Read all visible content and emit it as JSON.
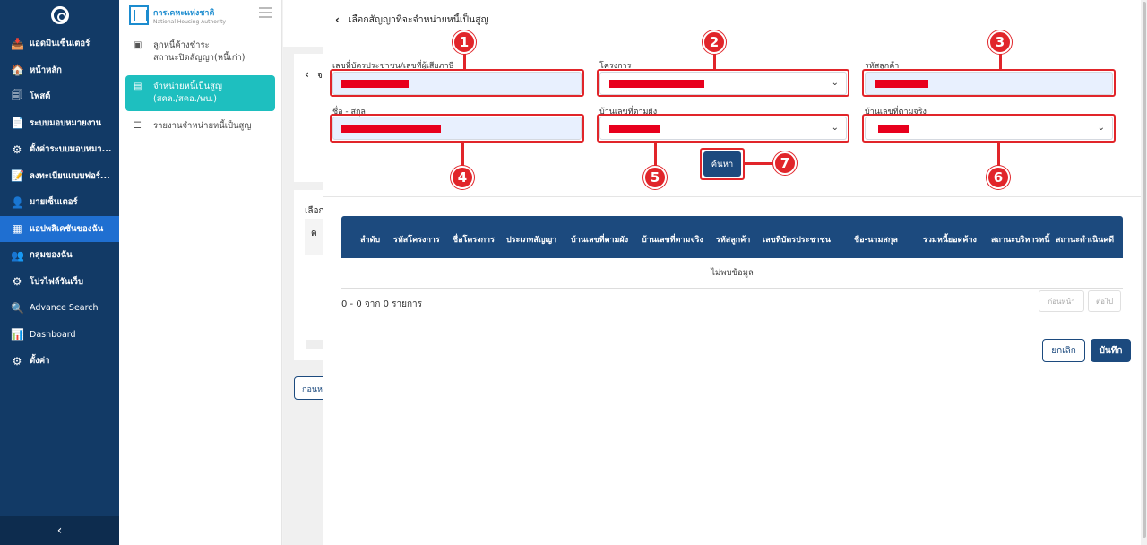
{
  "sidebar": {
    "items": [
      {
        "icon": "📥",
        "label": "แอดมินเซ็นเตอร์"
      },
      {
        "icon": "🏠",
        "label": "หน้าหลัก"
      },
      {
        "icon": "🗐",
        "label": "โพสต์"
      },
      {
        "icon": "📄",
        "label": "ระบบมอบหมายงาน"
      },
      {
        "icon": "⚙",
        "label": "ตั้งค่าระบบมอบหมา..."
      },
      {
        "icon": "📝",
        "label": "ลงทะเบียนแบบฟอร์..."
      },
      {
        "icon": "👤",
        "label": "มายเซ็นเตอร์"
      },
      {
        "icon": "▦",
        "label": "แอปพลิเคชันของฉัน"
      },
      {
        "icon": "👥",
        "label": "กลุ่มของฉัน"
      },
      {
        "icon": "⚙",
        "label": "โปรไฟล์วันเว็บ"
      },
      {
        "icon": "🔍",
        "label": "Advance Search"
      },
      {
        "icon": "📊",
        "label": "Dashboard"
      },
      {
        "icon": "⚙",
        "label": "ตั้งค่า"
      }
    ],
    "collapse_icon": "‹"
  },
  "brand": {
    "name_th": "การเคหะแห่งชาติ",
    "name_en": "National Housing Authority"
  },
  "subnav": {
    "items": [
      {
        "label_1": "ลูกหนี้ค้างชำระ",
        "label_2": "สถานะปิดสัญญา(หนี้เก่า)"
      },
      {
        "label_1": "จำหน่ายหนี้เป็นสูญ",
        "label_2": "(สคล./สคอ./พบ.)"
      },
      {
        "label_1": "รายงานจำหน่ายหนี้เป็นสูญ",
        "label_2": ""
      }
    ]
  },
  "background_page": {
    "back_symbol": "‹",
    "back_char": "จ",
    "label_1": "เลือก",
    "label_2": "ต",
    "prev_label": "ก่อนห"
  },
  "modal": {
    "title": "เลือกสัญญาที่จะจำหน่ายหนี้เป็นสูญ",
    "fields": {
      "id_label": "เลขที่บัตรประชาชน/เลขที่ผู้เสียภาษี",
      "project_label": "โครงการ",
      "customer_code_label": "รหัสลูกค้า",
      "name_label": "ชื่อ - สกุล",
      "house_reg_label": "บ้านเลขที่ตามผัง",
      "house_actual_label": "บ้านเลขที่ตามจริง"
    },
    "search_label": "ค้นหา",
    "table": {
      "headers": [
        "ลำดับ",
        "รหัสโครงการ",
        "ชื่อโครงการ",
        "ประเภทสัญญา",
        "บ้านเลขที่ตามผัง",
        "บ้านเลขที่ตามจริง",
        "รหัสลูกค้า",
        "เลขที่บัตรประชาชน",
        "ชื่อ-นามสกุล",
        "รวมหนี้ยอดค้าง",
        "สถานะบริหารหนี้",
        "สถานะดำเนินคดี"
      ],
      "empty_text": "ไม่พบข้อมูล",
      "record_count": "0 - 0 จาก 0 รายการ",
      "prev_label": "ก่อนหน้า",
      "next_label": "ต่อไป"
    },
    "cancel_label": "ยกเลิก",
    "save_label": "บันทึก"
  },
  "callouts": [
    "1",
    "2",
    "3",
    "4",
    "5",
    "6",
    "7"
  ],
  "colors": {
    "sidebar_bg": "#123a66",
    "active_blue": "#1f6fd1",
    "teal": "#1ebfbf",
    "primary": "#1c4a7e",
    "annotation_red": "#e1252a"
  }
}
